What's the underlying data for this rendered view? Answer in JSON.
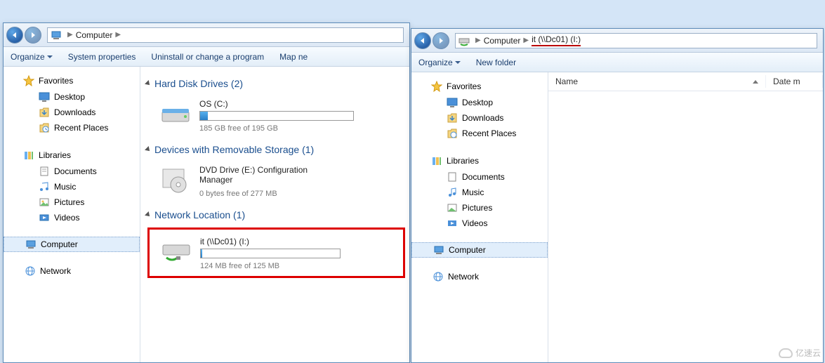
{
  "left": {
    "breadcrumb": {
      "root": "Computer"
    },
    "toolbar": {
      "organize": "Organize",
      "sys_props": "System properties",
      "uninstall": "Uninstall or change a program",
      "map": "Map ne"
    },
    "sidebar": {
      "favorites": {
        "label": "Favorites",
        "desktop": "Desktop",
        "downloads": "Downloads",
        "recent": "Recent Places"
      },
      "libraries": {
        "label": "Libraries",
        "documents": "Documents",
        "music": "Music",
        "pictures": "Pictures",
        "videos": "Videos"
      },
      "computer": "Computer",
      "network": "Network"
    },
    "content": {
      "hdd": {
        "title": "Hard Disk Drives (2)",
        "os_name": "OS (C:)",
        "os_free": "185 GB free of 195 GB",
        "os_fill_pct": 5
      },
      "removable": {
        "title": "Devices with Removable Storage (1)",
        "dvd_name": "DVD Drive (E:) Configuration Manager",
        "dvd_free": "0 bytes free of 277 MB"
      },
      "network": {
        "title": "Network Location (1)",
        "it_name": "it (\\\\Dc01) (I:)",
        "it_free": "124 MB free of 125 MB",
        "it_fill_pct": 1
      }
    }
  },
  "right": {
    "breadcrumb": {
      "root": "Computer",
      "leaf": "it (\\\\Dc01) (I:)"
    },
    "toolbar": {
      "organize": "Organize",
      "new_folder": "New folder"
    },
    "columns": {
      "name": "Name",
      "date": "Date m"
    },
    "sidebar": {
      "favorites": {
        "label": "Favorites",
        "desktop": "Desktop",
        "downloads": "Downloads",
        "recent": "Recent Places"
      },
      "libraries": {
        "label": "Libraries",
        "documents": "Documents",
        "music": "Music",
        "pictures": "Pictures",
        "videos": "Videos"
      },
      "computer": "Computer",
      "network": "Network"
    }
  },
  "watermark": "亿速云"
}
